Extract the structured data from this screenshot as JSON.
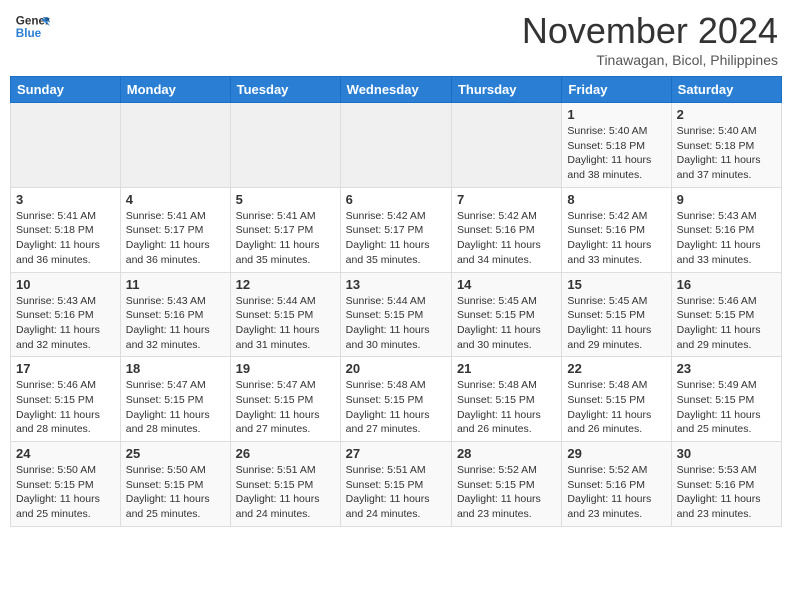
{
  "header": {
    "logo_general": "General",
    "logo_blue": "Blue",
    "month_title": "November 2024",
    "location": "Tinawagan, Bicol, Philippines"
  },
  "weekdays": [
    "Sunday",
    "Monday",
    "Tuesday",
    "Wednesday",
    "Thursday",
    "Friday",
    "Saturday"
  ],
  "weeks": [
    [
      {
        "day": "",
        "sunrise": "",
        "sunset": "",
        "daylight": "",
        "empty": true
      },
      {
        "day": "",
        "sunrise": "",
        "sunset": "",
        "daylight": "",
        "empty": true
      },
      {
        "day": "",
        "sunrise": "",
        "sunset": "",
        "daylight": "",
        "empty": true
      },
      {
        "day": "",
        "sunrise": "",
        "sunset": "",
        "daylight": "",
        "empty": true
      },
      {
        "day": "",
        "sunrise": "",
        "sunset": "",
        "daylight": "",
        "empty": true
      },
      {
        "day": "1",
        "sunrise": "Sunrise: 5:40 AM",
        "sunset": "Sunset: 5:18 PM",
        "daylight": "Daylight: 11 hours and 38 minutes.",
        "empty": false
      },
      {
        "day": "2",
        "sunrise": "Sunrise: 5:40 AM",
        "sunset": "Sunset: 5:18 PM",
        "daylight": "Daylight: 11 hours and 37 minutes.",
        "empty": false
      }
    ],
    [
      {
        "day": "3",
        "sunrise": "Sunrise: 5:41 AM",
        "sunset": "Sunset: 5:18 PM",
        "daylight": "Daylight: 11 hours and 36 minutes.",
        "empty": false
      },
      {
        "day": "4",
        "sunrise": "Sunrise: 5:41 AM",
        "sunset": "Sunset: 5:17 PM",
        "daylight": "Daylight: 11 hours and 36 minutes.",
        "empty": false
      },
      {
        "day": "5",
        "sunrise": "Sunrise: 5:41 AM",
        "sunset": "Sunset: 5:17 PM",
        "daylight": "Daylight: 11 hours and 35 minutes.",
        "empty": false
      },
      {
        "day": "6",
        "sunrise": "Sunrise: 5:42 AM",
        "sunset": "Sunset: 5:17 PM",
        "daylight": "Daylight: 11 hours and 35 minutes.",
        "empty": false
      },
      {
        "day": "7",
        "sunrise": "Sunrise: 5:42 AM",
        "sunset": "Sunset: 5:16 PM",
        "daylight": "Daylight: 11 hours and 34 minutes.",
        "empty": false
      },
      {
        "day": "8",
        "sunrise": "Sunrise: 5:42 AM",
        "sunset": "Sunset: 5:16 PM",
        "daylight": "Daylight: 11 hours and 33 minutes.",
        "empty": false
      },
      {
        "day": "9",
        "sunrise": "Sunrise: 5:43 AM",
        "sunset": "Sunset: 5:16 PM",
        "daylight": "Daylight: 11 hours and 33 minutes.",
        "empty": false
      }
    ],
    [
      {
        "day": "10",
        "sunrise": "Sunrise: 5:43 AM",
        "sunset": "Sunset: 5:16 PM",
        "daylight": "Daylight: 11 hours and 32 minutes.",
        "empty": false
      },
      {
        "day": "11",
        "sunrise": "Sunrise: 5:43 AM",
        "sunset": "Sunset: 5:16 PM",
        "daylight": "Daylight: 11 hours and 32 minutes.",
        "empty": false
      },
      {
        "day": "12",
        "sunrise": "Sunrise: 5:44 AM",
        "sunset": "Sunset: 5:15 PM",
        "daylight": "Daylight: 11 hours and 31 minutes.",
        "empty": false
      },
      {
        "day": "13",
        "sunrise": "Sunrise: 5:44 AM",
        "sunset": "Sunset: 5:15 PM",
        "daylight": "Daylight: 11 hours and 30 minutes.",
        "empty": false
      },
      {
        "day": "14",
        "sunrise": "Sunrise: 5:45 AM",
        "sunset": "Sunset: 5:15 PM",
        "daylight": "Daylight: 11 hours and 30 minutes.",
        "empty": false
      },
      {
        "day": "15",
        "sunrise": "Sunrise: 5:45 AM",
        "sunset": "Sunset: 5:15 PM",
        "daylight": "Daylight: 11 hours and 29 minutes.",
        "empty": false
      },
      {
        "day": "16",
        "sunrise": "Sunrise: 5:46 AM",
        "sunset": "Sunset: 5:15 PM",
        "daylight": "Daylight: 11 hours and 29 minutes.",
        "empty": false
      }
    ],
    [
      {
        "day": "17",
        "sunrise": "Sunrise: 5:46 AM",
        "sunset": "Sunset: 5:15 PM",
        "daylight": "Daylight: 11 hours and 28 minutes.",
        "empty": false
      },
      {
        "day": "18",
        "sunrise": "Sunrise: 5:47 AM",
        "sunset": "Sunset: 5:15 PM",
        "daylight": "Daylight: 11 hours and 28 minutes.",
        "empty": false
      },
      {
        "day": "19",
        "sunrise": "Sunrise: 5:47 AM",
        "sunset": "Sunset: 5:15 PM",
        "daylight": "Daylight: 11 hours and 27 minutes.",
        "empty": false
      },
      {
        "day": "20",
        "sunrise": "Sunrise: 5:48 AM",
        "sunset": "Sunset: 5:15 PM",
        "daylight": "Daylight: 11 hours and 27 minutes.",
        "empty": false
      },
      {
        "day": "21",
        "sunrise": "Sunrise: 5:48 AM",
        "sunset": "Sunset: 5:15 PM",
        "daylight": "Daylight: 11 hours and 26 minutes.",
        "empty": false
      },
      {
        "day": "22",
        "sunrise": "Sunrise: 5:48 AM",
        "sunset": "Sunset: 5:15 PM",
        "daylight": "Daylight: 11 hours and 26 minutes.",
        "empty": false
      },
      {
        "day": "23",
        "sunrise": "Sunrise: 5:49 AM",
        "sunset": "Sunset: 5:15 PM",
        "daylight": "Daylight: 11 hours and 25 minutes.",
        "empty": false
      }
    ],
    [
      {
        "day": "24",
        "sunrise": "Sunrise: 5:50 AM",
        "sunset": "Sunset: 5:15 PM",
        "daylight": "Daylight: 11 hours and 25 minutes.",
        "empty": false
      },
      {
        "day": "25",
        "sunrise": "Sunrise: 5:50 AM",
        "sunset": "Sunset: 5:15 PM",
        "daylight": "Daylight: 11 hours and 25 minutes.",
        "empty": false
      },
      {
        "day": "26",
        "sunrise": "Sunrise: 5:51 AM",
        "sunset": "Sunset: 5:15 PM",
        "daylight": "Daylight: 11 hours and 24 minutes.",
        "empty": false
      },
      {
        "day": "27",
        "sunrise": "Sunrise: 5:51 AM",
        "sunset": "Sunset: 5:15 PM",
        "daylight": "Daylight: 11 hours and 24 minutes.",
        "empty": false
      },
      {
        "day": "28",
        "sunrise": "Sunrise: 5:52 AM",
        "sunset": "Sunset: 5:15 PM",
        "daylight": "Daylight: 11 hours and 23 minutes.",
        "empty": false
      },
      {
        "day": "29",
        "sunrise": "Sunrise: 5:52 AM",
        "sunset": "Sunset: 5:16 PM",
        "daylight": "Daylight: 11 hours and 23 minutes.",
        "empty": false
      },
      {
        "day": "30",
        "sunrise": "Sunrise: 5:53 AM",
        "sunset": "Sunset: 5:16 PM",
        "daylight": "Daylight: 11 hours and 23 minutes.",
        "empty": false
      }
    ]
  ]
}
